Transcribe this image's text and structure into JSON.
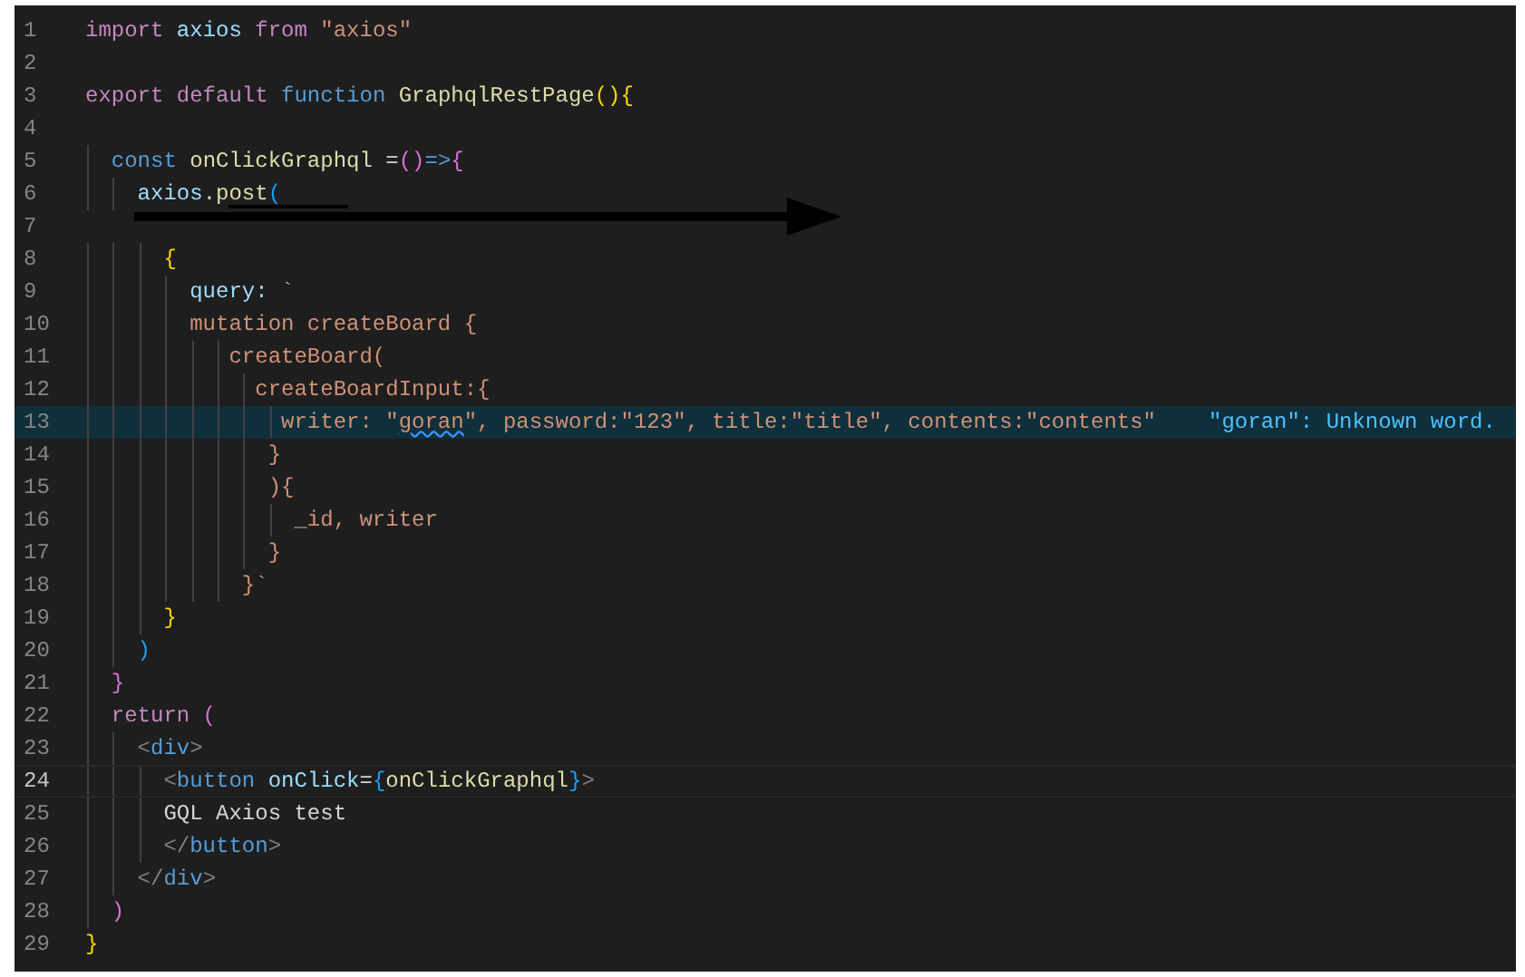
{
  "editor": {
    "lines": [
      {
        "number": "1",
        "kind": "code",
        "current": false,
        "highlighted": false,
        "tokens": [
          {
            "text": "import",
            "kind": "keyword"
          },
          {
            "text": " axios",
            "kind": "variable"
          },
          {
            "text": " from",
            "kind": "keyword"
          },
          {
            "text": " \"axios\"",
            "kind": "string"
          }
        ]
      },
      {
        "number": "2",
        "kind": "blank",
        "current": false,
        "highlighted": false
      },
      {
        "number": "3",
        "kind": "code",
        "current": false,
        "highlighted": false,
        "tokens": [
          {
            "text": "export default",
            "kind": "keyword"
          },
          {
            "text": " function",
            "kind": "storage"
          },
          {
            "text": " GraphqlRestPage",
            "kind": "function"
          },
          {
            "text": "(){",
            "kind": "brace1"
          }
        ]
      },
      {
        "number": "4",
        "kind": "blank",
        "current": false,
        "highlighted": false
      },
      {
        "number": "5",
        "kind": "code",
        "current": false,
        "highlighted": false,
        "tokens": [
          {
            "text": "  const",
            "kind": "storage"
          },
          {
            "text": " onClickGraphql",
            "kind": "function"
          },
          {
            "text": " =",
            "kind": "plain"
          },
          {
            "text": "()",
            "kind": "brace2"
          },
          {
            "text": "=>",
            "kind": "storage"
          },
          {
            "text": "{",
            "kind": "brace2"
          }
        ]
      },
      {
        "number": "6",
        "kind": "code",
        "current": false,
        "highlighted": false,
        "tokens": [
          {
            "text": "    axios",
            "kind": "variable"
          },
          {
            "text": ".",
            "kind": "plain"
          },
          {
            "text": "post",
            "kind": "function"
          },
          {
            "text": "(",
            "kind": "brace3"
          }
        ]
      },
      {
        "number": "7",
        "kind": "redacted",
        "current": false,
        "highlighted": false
      },
      {
        "number": "8",
        "kind": "code",
        "current": false,
        "highlighted": false,
        "tokens": [
          {
            "text": "      {",
            "kind": "brace1"
          }
        ]
      },
      {
        "number": "9",
        "kind": "code",
        "current": false,
        "highlighted": false,
        "tokens": [
          {
            "text": "        query:",
            "kind": "variable"
          },
          {
            "text": " `",
            "kind": "string"
          }
        ]
      },
      {
        "number": "10",
        "kind": "code",
        "current": false,
        "highlighted": false,
        "tokens": [
          {
            "text": "        mutation createBoard {",
            "kind": "string"
          }
        ]
      },
      {
        "number": "11",
        "kind": "code",
        "current": false,
        "highlighted": false,
        "tokens": [
          {
            "text": "           createBoard(",
            "kind": "string"
          }
        ]
      },
      {
        "number": "12",
        "kind": "code",
        "current": false,
        "highlighted": false,
        "tokens": [
          {
            "text": "             createBoardInput:{",
            "kind": "string"
          }
        ]
      },
      {
        "number": "13",
        "kind": "code",
        "current": false,
        "highlighted": true,
        "diagnostic": "\"goran\": Unknown word.",
        "tokens": [
          {
            "text": "               writer: \"",
            "kind": "string"
          },
          {
            "text": "goran",
            "kind": "misspelled"
          },
          {
            "text": "\", password:\"123\", title:\"title\", contents:\"contents\"",
            "kind": "string"
          }
        ]
      },
      {
        "number": "14",
        "kind": "code",
        "current": false,
        "highlighted": false,
        "tokens": [
          {
            "text": "              }",
            "kind": "string"
          }
        ]
      },
      {
        "number": "15",
        "kind": "code",
        "current": false,
        "highlighted": false,
        "tokens": [
          {
            "text": "              ){",
            "kind": "string"
          }
        ]
      },
      {
        "number": "16",
        "kind": "code",
        "current": false,
        "highlighted": false,
        "tokens": [
          {
            "text": "                _id, writer",
            "kind": "string"
          }
        ]
      },
      {
        "number": "17",
        "kind": "code",
        "current": false,
        "highlighted": false,
        "tokens": [
          {
            "text": "              }",
            "kind": "string"
          }
        ]
      },
      {
        "number": "18",
        "kind": "code",
        "current": false,
        "highlighted": false,
        "tokens": [
          {
            "text": "            }`",
            "kind": "string"
          }
        ]
      },
      {
        "number": "19",
        "kind": "code",
        "current": false,
        "highlighted": false,
        "tokens": [
          {
            "text": "      }",
            "kind": "brace1"
          }
        ]
      },
      {
        "number": "20",
        "kind": "code",
        "current": false,
        "highlighted": false,
        "tokens": [
          {
            "text": "    )",
            "kind": "brace3"
          }
        ]
      },
      {
        "number": "21",
        "kind": "code",
        "current": false,
        "highlighted": false,
        "tokens": [
          {
            "text": "  }",
            "kind": "brace2"
          }
        ]
      },
      {
        "number": "22",
        "kind": "code",
        "current": false,
        "highlighted": false,
        "tokens": [
          {
            "text": "  return",
            "kind": "keyword"
          },
          {
            "text": " (",
            "kind": "brace2"
          }
        ]
      },
      {
        "number": "23",
        "kind": "code",
        "current": false,
        "highlighted": false,
        "tokens": [
          {
            "text": "    <",
            "kind": "tag"
          },
          {
            "text": "div",
            "kind": "tagname"
          },
          {
            "text": ">",
            "kind": "tag"
          }
        ]
      },
      {
        "number": "24",
        "kind": "code",
        "current": true,
        "highlighted": false,
        "tokens": [
          {
            "text": "      <",
            "kind": "tag"
          },
          {
            "text": "button",
            "kind": "tagname"
          },
          {
            "text": " onClick",
            "kind": "attr"
          },
          {
            "text": "=",
            "kind": "plain"
          },
          {
            "text": "{",
            "kind": "brace3"
          },
          {
            "text": "onClickGraphql",
            "kind": "function"
          },
          {
            "text": "}",
            "kind": "brace3"
          },
          {
            "text": ">",
            "kind": "tag"
          }
        ]
      },
      {
        "number": "25",
        "kind": "code",
        "current": false,
        "highlighted": false,
        "tokens": [
          {
            "text": "      GQL Axios test",
            "kind": "plain"
          }
        ]
      },
      {
        "number": "26",
        "kind": "code",
        "current": false,
        "highlighted": false,
        "tokens": [
          {
            "text": "      </",
            "kind": "tag"
          },
          {
            "text": "button",
            "kind": "tagname"
          },
          {
            "text": ">",
            "kind": "tag"
          }
        ]
      },
      {
        "number": "27",
        "kind": "code",
        "current": false,
        "highlighted": false,
        "tokens": [
          {
            "text": "    </",
            "kind": "tag"
          },
          {
            "text": "div",
            "kind": "tagname"
          },
          {
            "text": ">",
            "kind": "tag"
          }
        ]
      },
      {
        "number": "28",
        "kind": "code",
        "current": false,
        "highlighted": false,
        "tokens": [
          {
            "text": "  )",
            "kind": "brace2"
          }
        ]
      },
      {
        "number": "29",
        "kind": "code",
        "current": false,
        "highlighted": false,
        "tokens": [
          {
            "text": "}",
            "kind": "brace1"
          }
        ]
      }
    ]
  }
}
